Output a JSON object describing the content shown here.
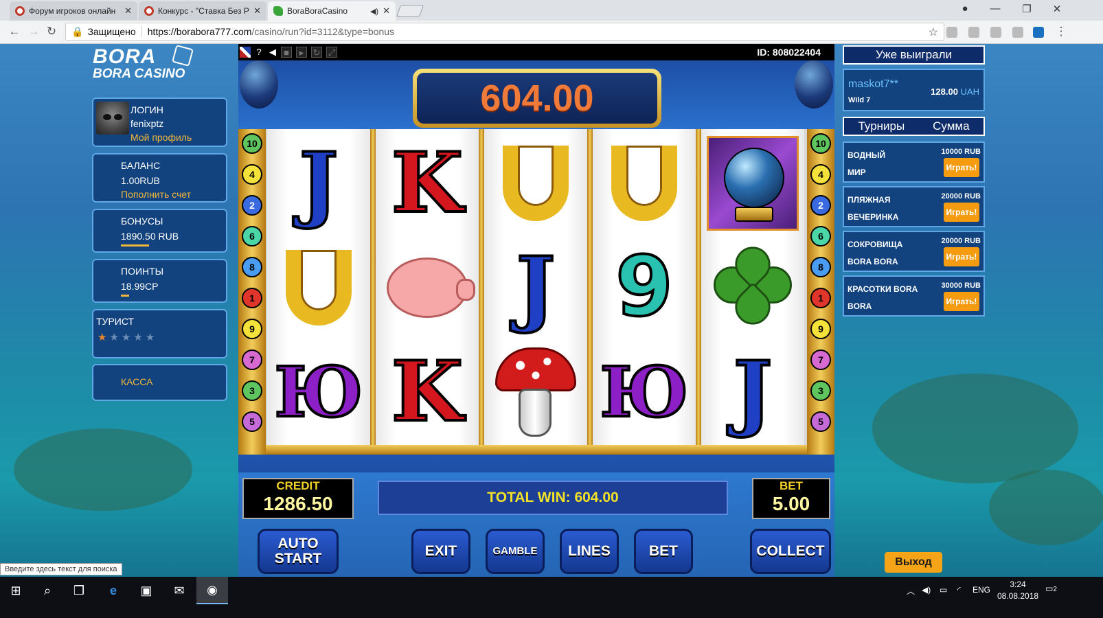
{
  "browser": {
    "tabs": [
      {
        "title": "Форум игроков онлайн",
        "icon": "forum-favicon-icon"
      },
      {
        "title": "Конкурс - \"Ставка Без Р",
        "icon": "forum-favicon-icon"
      },
      {
        "title": "BoraBoraCasino",
        "icon": "boraboracasino-favicon-icon"
      }
    ],
    "secure_label": "Защищено",
    "url_host": "https://borabora777.com",
    "url_path": "/casino/run?id=3112&type=bonus"
  },
  "left": {
    "logo_line1": "BORA",
    "logo_line2": "BORA CASINO",
    "login": {
      "title": "ЛОГИН",
      "value": "fenixptz",
      "link": "Мой профиль"
    },
    "balance": {
      "title": "БАЛАНС",
      "value": "1.00RUB",
      "link": "Пополнить счет"
    },
    "bonuses": {
      "title": "БОНУСЫ",
      "value": "1890.50 RUB",
      "progress": 0.27
    },
    "points": {
      "title": "ПОИНТЫ",
      "value": "18.99CP",
      "progress": 0.08
    },
    "rank": {
      "title": "ТУРИСТ",
      "stars_on": 1,
      "stars_total": 5
    },
    "cashier": "КАССА"
  },
  "game": {
    "id_label": "ID: 808022404",
    "win_display": "604.00",
    "line_numbers_left": [
      "10",
      "4",
      "2",
      "6",
      "8",
      "1",
      "9",
      "7",
      "3",
      "5"
    ],
    "line_numbers_right": [
      "10",
      "4",
      "2",
      "6",
      "8",
      "1",
      "9",
      "7",
      "3",
      "5"
    ],
    "reels": [
      [
        "J",
        "horseshoe",
        "Ю"
      ],
      [
        "K",
        "pig",
        "K"
      ],
      [
        "horseshoe",
        "J",
        "mushroom"
      ],
      [
        "horseshoe",
        "9",
        "Ю"
      ],
      [
        "crystal-ball",
        "clover",
        "J"
      ]
    ],
    "credit_label": "CREDIT",
    "credit_value": "1286.50",
    "total_win": "TOTAL WIN: 604.00",
    "bet_label": "BET",
    "bet_value": "5.00",
    "buttons": {
      "autostart_l1": "AUTO",
      "autostart_l2": "START",
      "exit": "EXIT",
      "gamble": "GAMBLE",
      "lines": "LINES",
      "bet": "BET",
      "collect": "COLLECT"
    }
  },
  "right": {
    "winners_header": "Уже выиграли",
    "winner": {
      "user": "maskot7**",
      "game": "Wild 7",
      "amount": "128.00",
      "currency": "UAH"
    },
    "tournaments_header_l": "Турниры",
    "tournaments_header_r": "Сумма",
    "tournaments": [
      {
        "name_l1": "ВОДНЫЙ",
        "name_l2": "МИР",
        "sum": "10000 RUB",
        "play": "Играть!"
      },
      {
        "name_l1": "ПЛЯЖНАЯ",
        "name_l2": "ВЕЧЕРИНКА",
        "sum": "20000 RUB",
        "play": "Играть!"
      },
      {
        "name_l1": "СОКРОВИЩА",
        "name_l2": "BORA BORA",
        "sum": "20000 RUB",
        "play": "Играть!"
      },
      {
        "name_l1": "КРАСОТКИ BORA",
        "name_l2": "BORA",
        "sum": "30000 RUB",
        "play": "Играть!"
      }
    ],
    "exit": "Выход"
  },
  "search_tip": "Введите здесь текст для поиска",
  "taskbar": {
    "lang": "ENG",
    "time": "3:24",
    "date": "08.08.2018",
    "notifications": "2"
  }
}
